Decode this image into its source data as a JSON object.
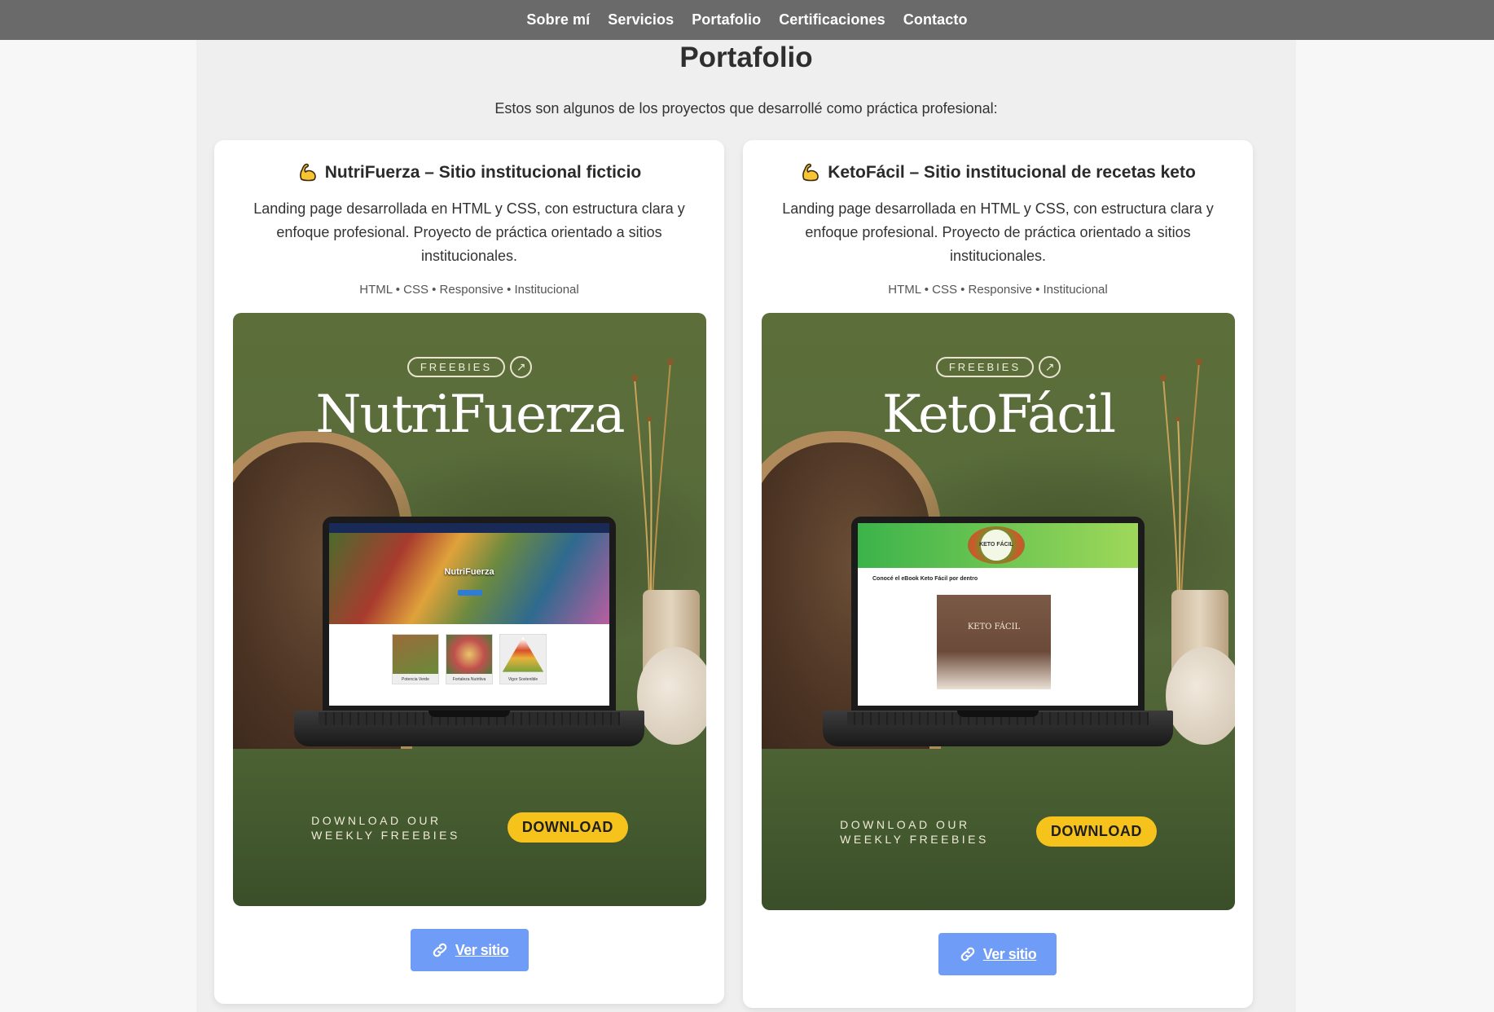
{
  "nav": {
    "items": [
      "Sobre mí",
      "Servicios",
      "Portafolio",
      "Certificaciones",
      "Contacto"
    ]
  },
  "section": {
    "title": "Portafolio",
    "intro": "Estos son algunos de los proyectos que desarrollé como práctica profesional:"
  },
  "projects": [
    {
      "icon": "flexed-biceps-icon",
      "title": "NutriFuerza – Sitio institucional ficticio",
      "description": "Landing page desarrollada en HTML y CSS, con estructura clara y enfoque profesional. Proyecto de práctica orientado a sitios institucionales.",
      "tags": "HTML • CSS • Responsive • Institucional",
      "mockup": {
        "badge": "FREEBIES",
        "brand": "NutriFuerza",
        "screen_title": "NutriFuerza",
        "thumbs": [
          "Potencia Verde",
          "Fortaleza Nutritiva",
          "Vigor Sostenible"
        ],
        "cta_line1": "DOWNLOAD OUR",
        "cta_line2": "WEEKLY FREEBIES",
        "cta_button": "DOWNLOAD"
      },
      "button": "Ver sitio"
    },
    {
      "icon": "flexed-biceps-icon",
      "title": "KetoFácil – Sitio institucional de recetas keto",
      "description": "Landing page desarrollada en HTML y CSS, con estructura clara y enfoque profesional. Proyecto de práctica orientado a sitios institucionales.",
      "tags": "HTML • CSS • Responsive • Institucional",
      "mockup": {
        "badge": "FREEBIES",
        "brand": "KetoFácil",
        "screen_logo": "KETO FÁCIL",
        "screen_heading": "Conocé el eBook Keto Fácil por dentro",
        "screen_book": "KETO FÁCIL",
        "cta_line1": "DOWNLOAD OUR",
        "cta_line2": "WEEKLY FREEBIES",
        "cta_button": "DOWNLOAD"
      },
      "button": "Ver sitio"
    }
  ],
  "colors": {
    "navbar": "#6a6a6a",
    "accent_button": "#6f9cf6",
    "download_button": "#f6c21c",
    "mockup_green": "#55683a"
  }
}
